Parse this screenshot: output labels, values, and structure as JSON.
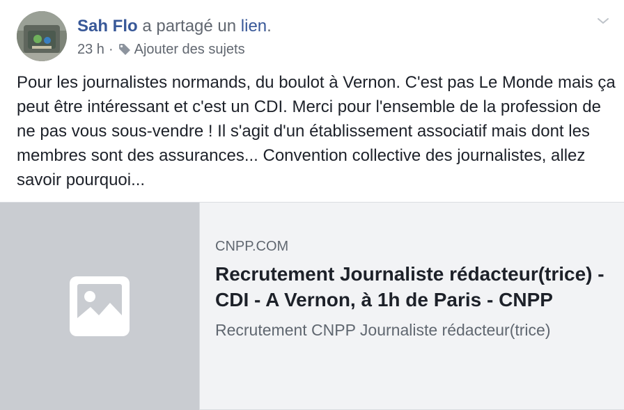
{
  "post": {
    "author": "Sah Flo",
    "shared_text": " a partagé un ",
    "link_word": "lien",
    "period": ".",
    "time": "23 h",
    "separator": "·",
    "add_topics": "Ajouter des sujets",
    "menu_icon": "chevron-down-icon",
    "body": "Pour les journalistes normands, du boulot à Vernon. C'est pas Le Monde mais ça peut être intéressant et c'est un CDI. Merci pour l'ensemble de la profession de ne pas vous sous-vendre ! Il s'agit d'un établissement associatif mais dont les membres sont des assurances... Convention collective des journalistes, allez savoir pourquoi..."
  },
  "link_card": {
    "domain": "CNPP.COM",
    "title": "Recrutement Journaliste rédacteur(trice) - CDI - A Vernon, à 1h de Paris - CNPP",
    "description": "Recrutement CNPP Journaliste rédacteur(trice)",
    "thumbnail_icon": "image-placeholder-icon"
  },
  "colors": {
    "link": "#385898",
    "text": "#1d2129",
    "meta": "#616770",
    "thumb_bg": "#c9ccd1",
    "card_bg": "#f2f3f5"
  }
}
